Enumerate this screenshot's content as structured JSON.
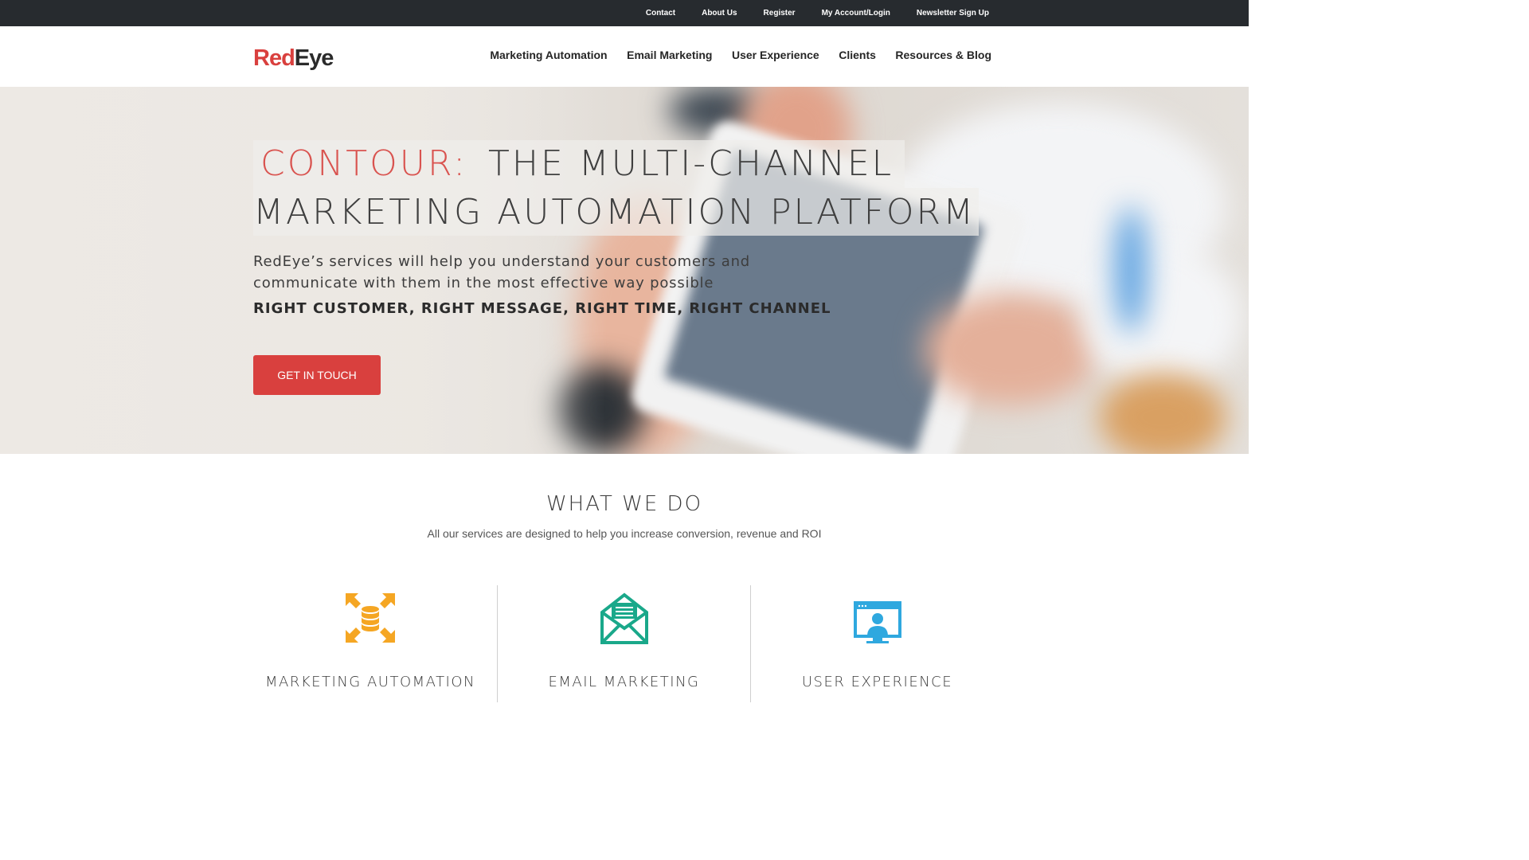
{
  "topbar": {
    "links": [
      "Contact",
      "About Us",
      "Register",
      "My Account/Login",
      "Newsletter Sign Up"
    ]
  },
  "header": {
    "logo_red": "Red",
    "logo_dark": "Eye",
    "nav": [
      "Marketing Automation",
      "Email Marketing",
      "User Experience",
      "Clients",
      "Resources & Blog"
    ]
  },
  "hero": {
    "headline_accent": "CONTOUR:",
    "headline_rest": "THE MULTI-CHANNEL",
    "headline_line2": "MARKETING AUTOMATION PLATFORM",
    "subtext": "RedEye’s services will help you understand your customers and communicate with them in the most effective way possible",
    "tagline": "RIGHT CUSTOMER, RIGHT MESSAGE, RIGHT TIME, RIGHT CHANNEL",
    "cta_label": "GET IN TOUCH"
  },
  "what_we_do": {
    "title": "WHAT WE DO",
    "subtitle": "All our services are designed to help you increase conversion, revenue and ROI",
    "services": [
      {
        "label": "MARKETING AUTOMATION",
        "icon": "database-expand-icon",
        "color": "#f5a623"
      },
      {
        "label": "EMAIL MARKETING",
        "icon": "envelope-icon",
        "color": "#1aa88a"
      },
      {
        "label": "USER EXPERIENCE",
        "icon": "monitor-user-icon",
        "color": "#2fa8df"
      }
    ]
  },
  "colors": {
    "brand_red": "#d9403e",
    "topbar_bg": "#272b2f"
  }
}
